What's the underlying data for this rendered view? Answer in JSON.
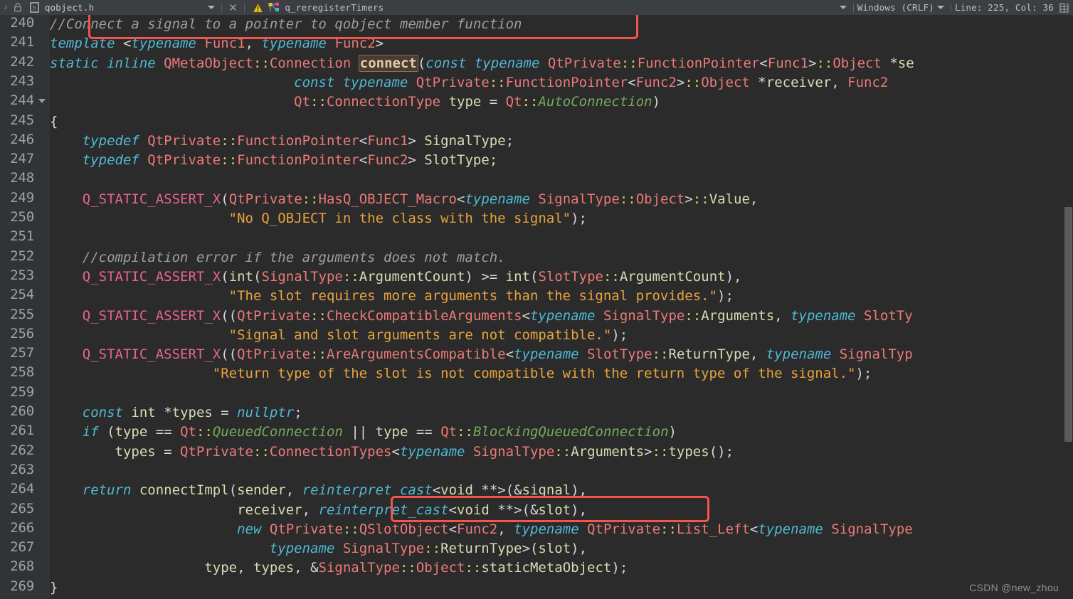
{
  "topbar": {
    "chevron": "›",
    "lock_icon": "lock-icon",
    "file_icon": "file-h-icon",
    "tab_title": "qobject.h",
    "dropdown_icon": "chevron-down-icon",
    "close_icon": "close-icon",
    "warning_icon": "warning-triangle-icon",
    "structure_icon": "structure-icon",
    "breadcrumb": "q_reregisterTimers",
    "right_dropdown_icon": "chevron-down-icon",
    "line_ending": "Windows (CRLF)",
    "encoding_dropdown_icon": "chevron-down-icon",
    "caret_position": "Line: 225, Col: 36",
    "grid_icon": "grid-icon"
  },
  "editor": {
    "first_line_number": 240,
    "line_numbers": [
      240,
      241,
      242,
      243,
      244,
      245,
      246,
      247,
      248,
      249,
      250,
      251,
      252,
      253,
      254,
      255,
      256,
      257,
      258,
      259,
      260,
      261,
      262,
      263,
      264,
      265,
      266,
      267,
      268,
      269
    ],
    "fold_marker_line": 244,
    "selected_token": "connect",
    "lines": [
      "//Connect a signal to a pointer to qobject member function",
      "template <typename Func1, typename Func2>",
      "static inline QMetaObject::Connection connect(const typename QtPrivate::FunctionPointer<Func1>::Object *se",
      "                              const typename QtPrivate::FunctionPointer<Func2>::Object *receiver, Func2",
      "                              Qt::ConnectionType type = Qt::AutoConnection)",
      "{",
      "    typedef QtPrivate::FunctionPointer<Func1> SignalType;",
      "    typedef QtPrivate::FunctionPointer<Func2> SlotType;",
      "",
      "    Q_STATIC_ASSERT_X(QtPrivate::HasQ_OBJECT_Macro<typename SignalType::Object>::Value,",
      "                      \"No Q_OBJECT in the class with the signal\");",
      "",
      "    //compilation error if the arguments does not match.",
      "    Q_STATIC_ASSERT_X(int(SignalType::ArgumentCount) >= int(SlotType::ArgumentCount),",
      "                      \"The slot requires more arguments than the signal provides.\");",
      "    Q_STATIC_ASSERT_X((QtPrivate::CheckCompatibleArguments<typename SignalType::Arguments, typename SlotTy",
      "                      \"Signal and slot arguments are not compatible.\");",
      "    Q_STATIC_ASSERT_X((QtPrivate::AreArgumentsCompatible<typename SlotType::ReturnType, typename SignalTyp",
      "                      \"Return type of the slot is not compatible with the return type of the signal.\");",
      "",
      "    const int *types = nullptr;",
      "    if (type == Qt::QueuedConnection || type == Qt::BlockingQueuedConnection)",
      "        types = QtPrivate::ConnectionTypes<typename SignalType::Arguments>::types();",
      "",
      "    return connectImpl(sender, reinterpret_cast<void **>(&signal),",
      "                       receiver, reinterpret_cast<void **>(&slot),",
      "                       new QtPrivate::QSlotObject<Func2, typename QtPrivate::List_Left<typename SignalType",
      "                           typename SignalType::ReturnType>(slot),",
      "                       type, types, &SignalType::Object::staticMetaObject);",
      "}"
    ]
  },
  "annotations": [
    {
      "name": "comment-highlight-box",
      "label": "//Connect a signal to a pointer to qobject member function"
    },
    {
      "name": "reinterpret-cast-highlight-box",
      "label": "reinterpret_cast<void **>(&slot),"
    }
  ],
  "watermark": {
    "text": "CSDN @new_zhou"
  },
  "colors": {
    "editor_background": "#2b2b2b",
    "gutter_background": "#313335",
    "topbar_background": "#3c3f41",
    "annotation_red": "#f4544a",
    "keyword": "#4eb8d4",
    "type": "#ec7a78",
    "identifier": "#d9dbb2",
    "comment": "#9b9fa3",
    "string": "#e8a33d",
    "macro": "#e8648c",
    "enum_constant": "#76a95b",
    "scope_operator": "#d8d36a",
    "selection_background": "#4a3b35"
  }
}
